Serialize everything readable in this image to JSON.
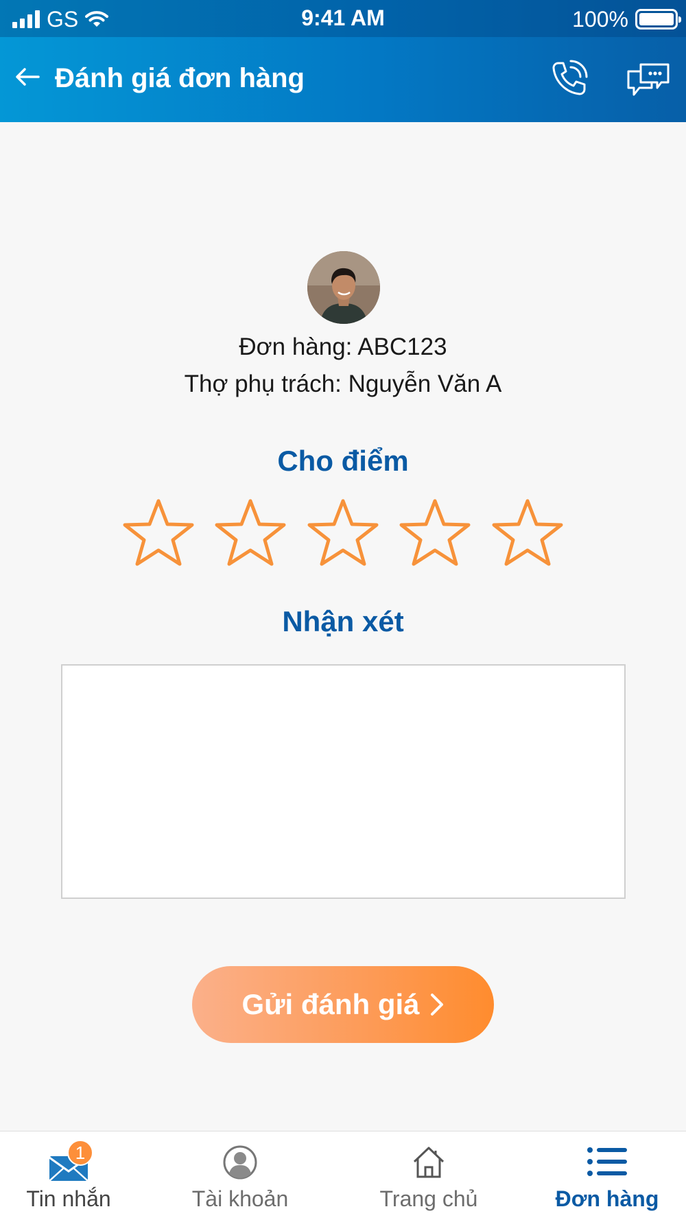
{
  "status_bar": {
    "carrier": "GS",
    "time": "9:41 AM",
    "battery": "100%"
  },
  "header": {
    "title": "Đánh giá đơn hàng"
  },
  "order": {
    "order_label": "Đơn hàng:",
    "order_code": "ABC123",
    "technician_label": "Thợ phụ trách:",
    "technician_name": "Nguyễn Văn A"
  },
  "rating": {
    "title": "Cho điểm",
    "max_stars": 5,
    "selected": 0,
    "star_color": "#f7923a"
  },
  "comment": {
    "title": "Nhận xét",
    "value": "",
    "placeholder": ""
  },
  "submit": {
    "label": "Gửi đánh giá"
  },
  "tabs": [
    {
      "label": "Tin nhắn",
      "icon": "envelope-icon",
      "badge": "1",
      "active": false
    },
    {
      "label": "Tài khoản",
      "icon": "user-icon",
      "active": false
    },
    {
      "label": "Trang chủ",
      "icon": "home-icon",
      "active": false
    },
    {
      "label": "Đơn hàng",
      "icon": "list-icon",
      "active": true
    }
  ],
  "colors": {
    "header_start": "#0497d6",
    "header_end": "#075fa8",
    "accent_blue": "#0a5aa4",
    "accent_orange": "#fd8f3a",
    "tab_inactive": "#6d6d6d",
    "tab_active": "#0a5aa4"
  }
}
